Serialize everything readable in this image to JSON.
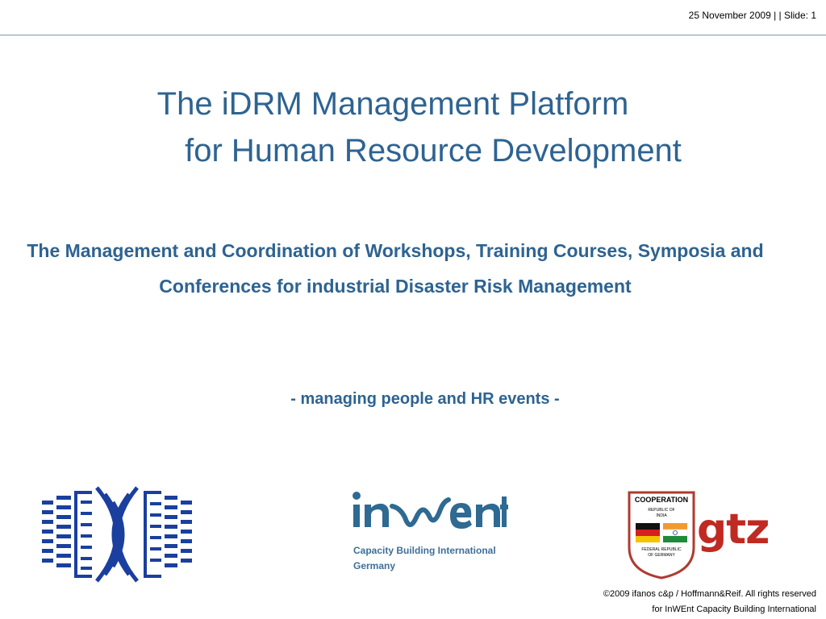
{
  "header": {
    "meta": "25 November 2009 |  | Slide: 1"
  },
  "slide": {
    "title_line1": "The iDRM Management Platform",
    "title_line2": "for Human Resource Development",
    "subtitle": "The Management and Coordination of Workshops, Training Courses, Symposia and Conferences for industrial Disaster Risk Management",
    "tagline": "- managing people and HR events -"
  },
  "logos": {
    "inwent_name": "inWEnt",
    "inwent_caption_line1": "Capacity Building International",
    "inwent_caption_line2": "Germany",
    "coop_title": "COOPERATION",
    "coop_country1_line1": "REPUBLIC OF",
    "coop_country1_line2": "INDIA",
    "coop_country2_line1": "FEDERAL REPUBLIC",
    "coop_country2_line2": "OF GERMANY",
    "gtz_name": "gtz"
  },
  "footer": {
    "copyright_line1": "©2009 ifanos c&p / Hoffmann&Reif. All rights reserved",
    "copyright_line2": "for InWEnt Capacity Building International"
  },
  "colors": {
    "title_blue": "#2e6391",
    "idrm_blue": "#1a3f9e",
    "gtz_red": "#c02a22"
  }
}
